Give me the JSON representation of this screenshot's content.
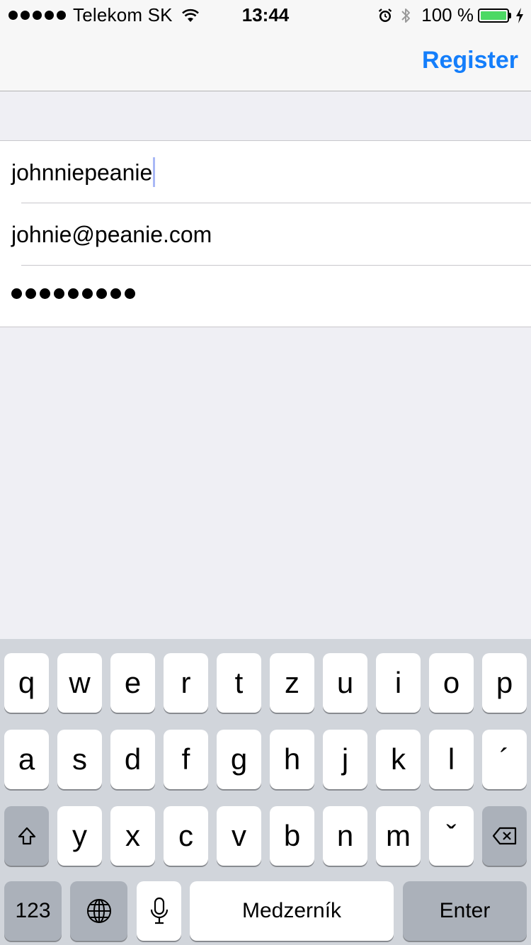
{
  "status_bar": {
    "carrier": "Telekom SK",
    "time": "13:44",
    "battery_percent": "100 %",
    "battery_level": 1.0,
    "battery_color": "#4cd964",
    "icons": [
      "signal-dots-icon",
      "wifi-icon",
      "alarm-icon",
      "bluetooth-icon",
      "battery-icon",
      "charging-bolt-icon"
    ]
  },
  "navbar": {
    "right_button": "Register",
    "accent": "#147efb"
  },
  "form": {
    "username": "johnniepeanie",
    "email": "johnie@peanie.com",
    "password_mask": "●●●●●●●●●",
    "password_length": 9
  },
  "keyboard": {
    "row1": [
      "q",
      "w",
      "e",
      "r",
      "t",
      "z",
      "u",
      "i",
      "o",
      "p"
    ],
    "row2": [
      "a",
      "s",
      "d",
      "f",
      "g",
      "h",
      "j",
      "k",
      "l",
      "´"
    ],
    "row3": [
      "y",
      "x",
      "c",
      "v",
      "b",
      "n",
      "m",
      "ˇ"
    ],
    "numbers_key": "123",
    "space_key": "Medzerník",
    "enter_key": "Enter",
    "icons": [
      "shift-icon",
      "backspace-icon",
      "globe-icon",
      "microphone-icon"
    ]
  }
}
